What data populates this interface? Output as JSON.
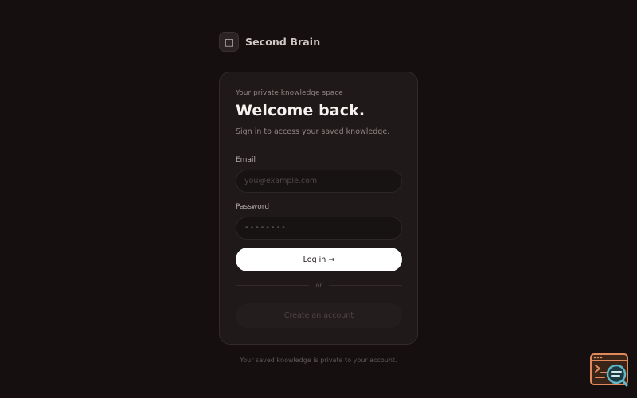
{
  "brand": {
    "logo_glyph": "□",
    "name": "Second Brain"
  },
  "card": {
    "eyebrow": "Your private knowledge space",
    "title": "Welcome back.",
    "subtitle": "Sign in to access your saved knowledge.",
    "email": {
      "label": "Email",
      "placeholder": "you@example.com",
      "value": ""
    },
    "password": {
      "label": "Password",
      "placeholder": "••••••••",
      "value": ""
    },
    "login_label": "Log in →",
    "divider_text": "or",
    "create_label": "Create an account"
  },
  "footer": {
    "text": "Your saved knowledge is private to your account."
  },
  "colors": {
    "background": "#150f0f",
    "card": "#1f1919",
    "primary_button": "#ffffff",
    "widget_accent": "#e08a5c",
    "widget_lens": "#5fb8c9"
  },
  "icons": {
    "brand": "brain-logo-icon",
    "corner_widget": "browser-search-icon"
  }
}
